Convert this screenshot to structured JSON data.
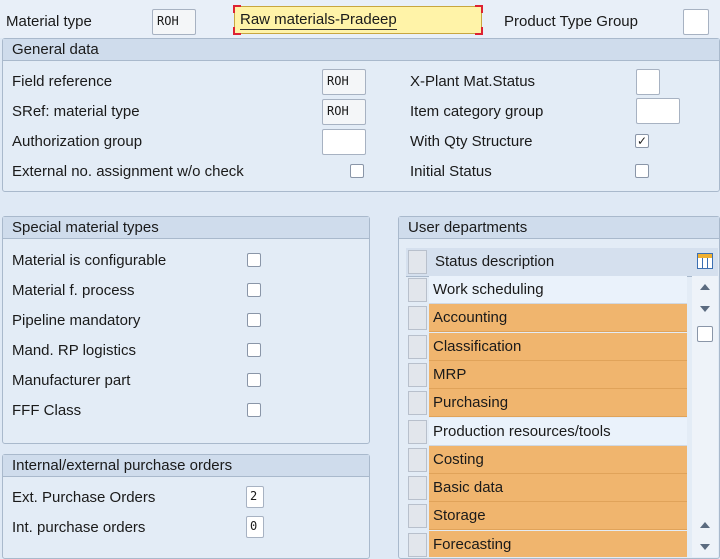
{
  "header": {
    "material_type_label": "Material type",
    "material_type_code": "ROH",
    "material_type_desc": "Raw materials-Pradeep",
    "product_type_group_label": "Product Type Group",
    "product_type_group_value": ""
  },
  "general": {
    "title": "General data",
    "field_reference_label": "Field reference",
    "field_reference_value": "ROH",
    "sref_label": "SRef: material type",
    "sref_value": "ROH",
    "auth_group_label": "Authorization group",
    "auth_group_value": "",
    "ext_no_label": "External no. assignment w/o check",
    "ext_no_checked": false,
    "xplant_label": "X-Plant Mat.Status",
    "xplant_value": "",
    "item_cat_label": "Item category group",
    "item_cat_value": "",
    "qty_struct_label": "With Qty Structure",
    "qty_struct_checked": true,
    "initial_status_label": "Initial Status",
    "initial_status_checked": false
  },
  "special": {
    "title": "Special material types",
    "items": [
      {
        "label": "Material is configurable",
        "checked": false
      },
      {
        "label": "Material f. process",
        "checked": false
      },
      {
        "label": "Pipeline mandatory",
        "checked": false
      },
      {
        "label": "Mand. RP logistics",
        "checked": false
      },
      {
        "label": "Manufacturer part",
        "checked": false
      },
      {
        "label": "FFF Class",
        "checked": false
      }
    ]
  },
  "orders": {
    "title": "Internal/external purchase orders",
    "ext_label": "Ext. Purchase Orders",
    "ext_value": "2",
    "int_label": "Int. purchase orders",
    "int_value": "0"
  },
  "departments": {
    "title": "User departments",
    "column_header": "Status description",
    "highlight_color": "#f0b56e",
    "rows": [
      {
        "label": "Work scheduling",
        "highlighted": false
      },
      {
        "label": "Accounting",
        "highlighted": true
      },
      {
        "label": "Classification",
        "highlighted": true
      },
      {
        "label": "MRP",
        "highlighted": true
      },
      {
        "label": "Purchasing",
        "highlighted": true
      },
      {
        "label": "Production resources/tools",
        "highlighted": false
      },
      {
        "label": "Costing",
        "highlighted": true
      },
      {
        "label": "Basic data",
        "highlighted": true
      },
      {
        "label": "Storage",
        "highlighted": true
      },
      {
        "label": "Forecasting",
        "highlighted": true
      }
    ]
  }
}
